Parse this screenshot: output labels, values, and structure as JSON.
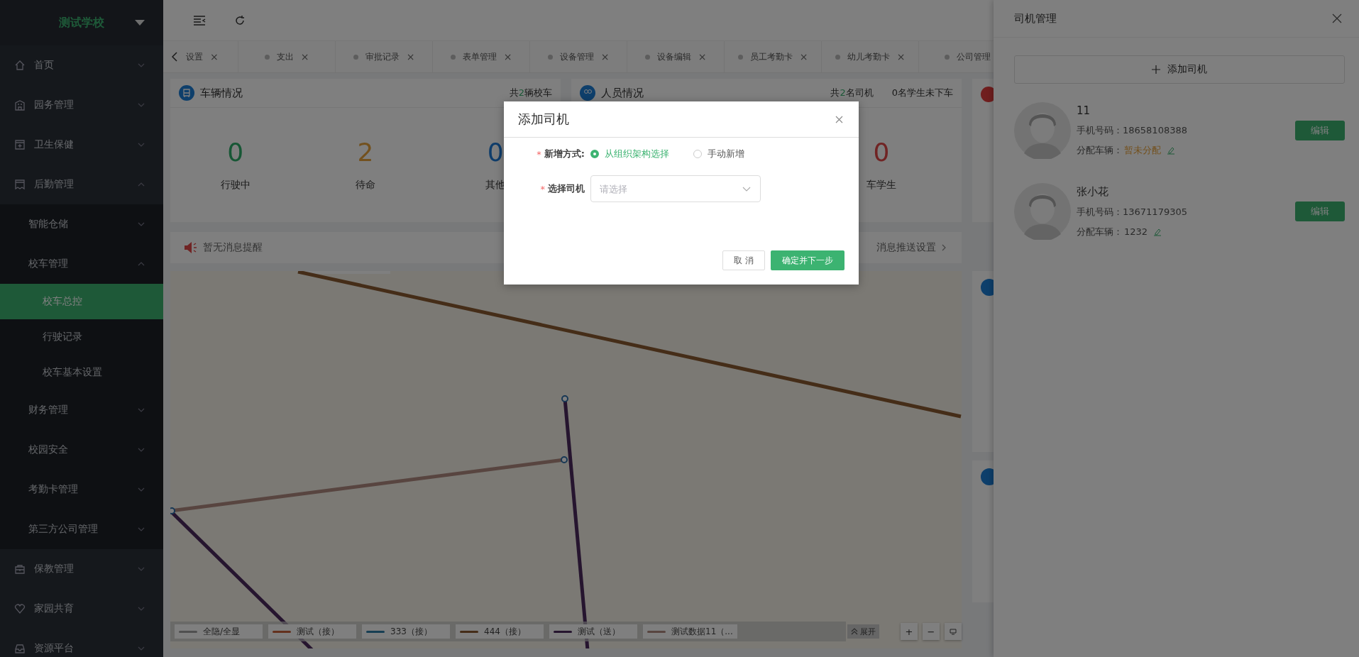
{
  "sidebar": {
    "logo": "测试学校",
    "items": [
      {
        "label": "首页",
        "expanded": false,
        "selected": false
      },
      {
        "label": "园务管理",
        "expanded": false,
        "selected": false
      },
      {
        "label": "卫生保健",
        "expanded": false,
        "selected": false
      },
      {
        "label": "后勤管理",
        "expanded": true,
        "selected": false,
        "children": [
          {
            "label": "智能仓储",
            "expanded": false,
            "selected": false
          },
          {
            "label": "校车管理",
            "expanded": true,
            "selected": false,
            "children": [
              {
                "label": "校车总控",
                "selected": true
              },
              {
                "label": "行驶记录",
                "selected": false
              },
              {
                "label": "校车基本设置",
                "selected": false
              }
            ]
          },
          {
            "label": "财务管理",
            "expanded": false,
            "selected": false
          },
          {
            "label": "校园安全",
            "expanded": false,
            "selected": false
          },
          {
            "label": "考勤卡管理",
            "expanded": false,
            "selected": false
          },
          {
            "label": "第三方公司管理",
            "expanded": false,
            "selected": false
          }
        ]
      },
      {
        "label": "保教管理",
        "expanded": false,
        "selected": false
      },
      {
        "label": "家园共育",
        "expanded": false,
        "selected": false
      },
      {
        "label": "资源平台",
        "expanded": false,
        "selected": false
      }
    ]
  },
  "tabs": [
    {
      "label": "设置",
      "close": "×",
      "selected": false,
      "dot": false
    },
    {
      "label": "支出",
      "close": "×",
      "selected": false,
      "dot": true
    },
    {
      "label": "审批记录",
      "close": "×",
      "selected": false,
      "dot": true
    },
    {
      "label": "表单管理",
      "close": "×",
      "selected": false,
      "dot": true
    },
    {
      "label": "设备管理",
      "close": "×",
      "selected": false,
      "dot": true
    },
    {
      "label": "设备编辑",
      "close": "×",
      "selected": false,
      "dot": true
    },
    {
      "label": "员工考勤卡",
      "close": "×",
      "selected": false,
      "dot": true
    },
    {
      "label": "幼儿考勤卡",
      "close": "×",
      "selected": false,
      "dot": true
    },
    {
      "label": "公司管理",
      "selected": false,
      "dot": true
    }
  ],
  "vehicle_card": {
    "title": "车辆情况",
    "total": {
      "pre": "共",
      "num": "2",
      "post": "辆校车"
    },
    "stats": [
      {
        "value": "0",
        "label": "行驶中",
        "color": "#175735"
      },
      {
        "value": "2",
        "label": "待命",
        "color": "#73511e"
      },
      {
        "value": "0",
        "label": "其他",
        "color": "#0f3d6b"
      }
    ]
  },
  "staff_card": {
    "title": "人员情况",
    "total": {
      "pre": "共",
      "num": "2",
      "post": "名司机"
    },
    "extra": "0名学生未下车",
    "stat": {
      "value": "0",
      "label": "车学生",
      "color": "#702424"
    }
  },
  "message_bar": {
    "text": "暂无消息提醒",
    "link": "消息推送设置"
  },
  "map": {
    "legend": [
      {
        "label": "全隐/全显",
        "color": "#505050"
      },
      {
        "label": "测试（接）",
        "color": "#64311d"
      },
      {
        "label": "333（接）",
        "color": "#173f54"
      },
      {
        "label": "444（接）",
        "color": "#452d18"
      },
      {
        "label": "测试（送）",
        "color": "#26152f"
      },
      {
        "label": "测试数据11（...",
        "color": "#584540"
      }
    ],
    "expand": "展开",
    "zoom_in": "+",
    "zoom_out": "−"
  },
  "drawer": {
    "title": "司机管理",
    "add": "添加司机",
    "drivers": [
      {
        "name": "11",
        "phone_label": "手机号码：",
        "phone": "18658108388",
        "vehicle_label": "分配车辆：",
        "vehicle": "暂未分配",
        "assigned": false,
        "edit": "编辑"
      },
      {
        "name": "张小花",
        "phone_label": "手机号码：",
        "phone": "13671179305",
        "vehicle_label": "分配车辆：",
        "vehicle": "1232",
        "assigned": true,
        "edit": "编辑"
      }
    ]
  },
  "modal": {
    "title": "添加司机",
    "mode_mark": "*",
    "mode_label": "新增方式:",
    "options": [
      {
        "label": "从组织架构选择",
        "selected": true
      },
      {
        "label": "手动新增",
        "selected": false
      }
    ],
    "driver_mark": "*",
    "driver_label": "选择司机",
    "placeholder": "请选择",
    "cancel": "取 消",
    "ok": "确定并下一步"
  }
}
